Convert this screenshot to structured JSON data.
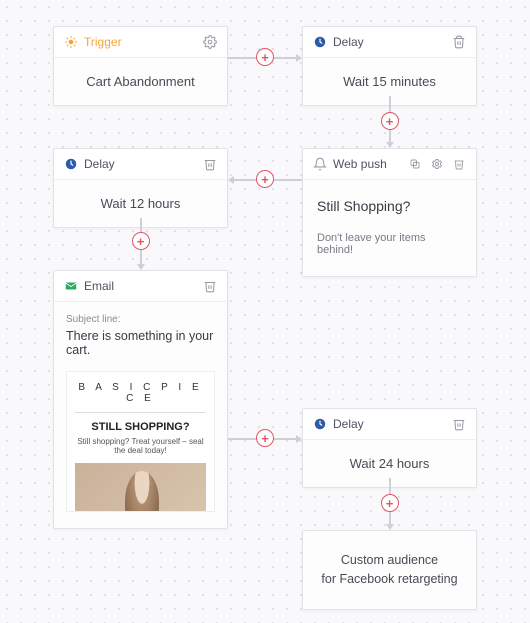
{
  "nodes": {
    "trigger": {
      "type_label": "Trigger",
      "body": "Cart Abandonment"
    },
    "delay15": {
      "type_label": "Delay",
      "body": "Wait 15 minutes"
    },
    "delay12": {
      "type_label": "Delay",
      "body": "Wait 12 hours"
    },
    "webpush": {
      "type_label": "Web push",
      "headline": "Still Shopping?",
      "sub": "Don't leave your items behind!"
    },
    "email": {
      "type_label": "Email",
      "subject_label": "Subject line:",
      "subject_text": "There is something in your cart.",
      "preview": {
        "brand": "B A S I C  P I E C E",
        "heading": "STILL SHOPPING?",
        "tagline": "Still shopping? Treat yourself – seal the deal today!"
      }
    },
    "delay24": {
      "type_label": "Delay",
      "body": "Wait 24 hours"
    },
    "audience": {
      "line1": "Custom audience",
      "line2": "for Facebook retargeting"
    }
  },
  "icons": {
    "trigger": "sun-icon",
    "delay": "clock-icon",
    "webpush": "bell-icon",
    "email": "envelope-icon",
    "settings": "gear-icon",
    "delete": "trash-icon",
    "copy": "copy-icon"
  }
}
